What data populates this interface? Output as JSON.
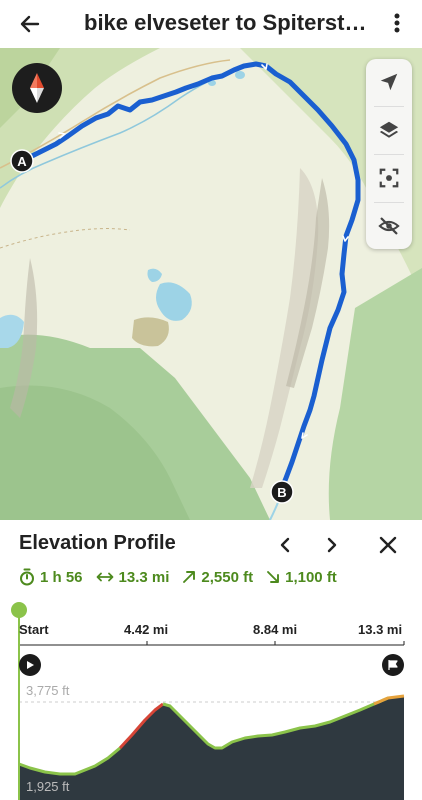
{
  "header": {
    "back_icon": "arrow-left-icon",
    "title": "bike elveseter to Spiterstulen",
    "more_icon": "more-vertical-icon"
  },
  "map": {
    "compass_icon": "compass-icon",
    "tools": [
      "locate-icon",
      "layers-icon",
      "focus-icon",
      "visibility-off-icon"
    ],
    "markers": {
      "start": "A",
      "end": "B"
    },
    "route_color": "#1a5fd0"
  },
  "panel": {
    "title": "Elevation Profile",
    "prev_icon": "chevron-left-icon",
    "next_icon": "chevron-right-icon",
    "close_icon": "close-icon",
    "stats": {
      "duration": "1 h 56",
      "distance": "13.3 mi",
      "ascent": "2,550 ft",
      "descent": "1,100 ft"
    },
    "accent": "#4d8a1e"
  },
  "profile": {
    "ticks": [
      "Start",
      "4.42 mi",
      "8.84 mi",
      "13.3 mi"
    ],
    "max_label": "3,775 ft",
    "min_label": "1,925 ft"
  }
}
